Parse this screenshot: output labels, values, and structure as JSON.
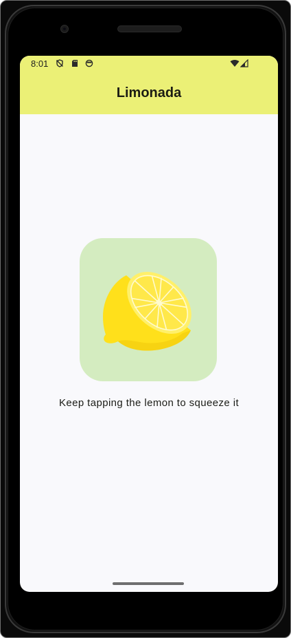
{
  "status_bar": {
    "time": "8:01",
    "left_icons": [
      "shield-off-icon",
      "sd-card-icon",
      "face-icon"
    ],
    "right_icons": [
      "wifi-icon",
      "cell-signal-icon"
    ]
  },
  "app_bar": {
    "title": "Limonada"
  },
  "main": {
    "image": "lemon-half-icon",
    "instruction": "Keep tapping the lemon to squeeze it"
  },
  "colors": {
    "app_bar": "#ebf076",
    "background": "#f9f9fc",
    "image_container": "#d4ecc0",
    "lemon": "#ffe01b"
  }
}
